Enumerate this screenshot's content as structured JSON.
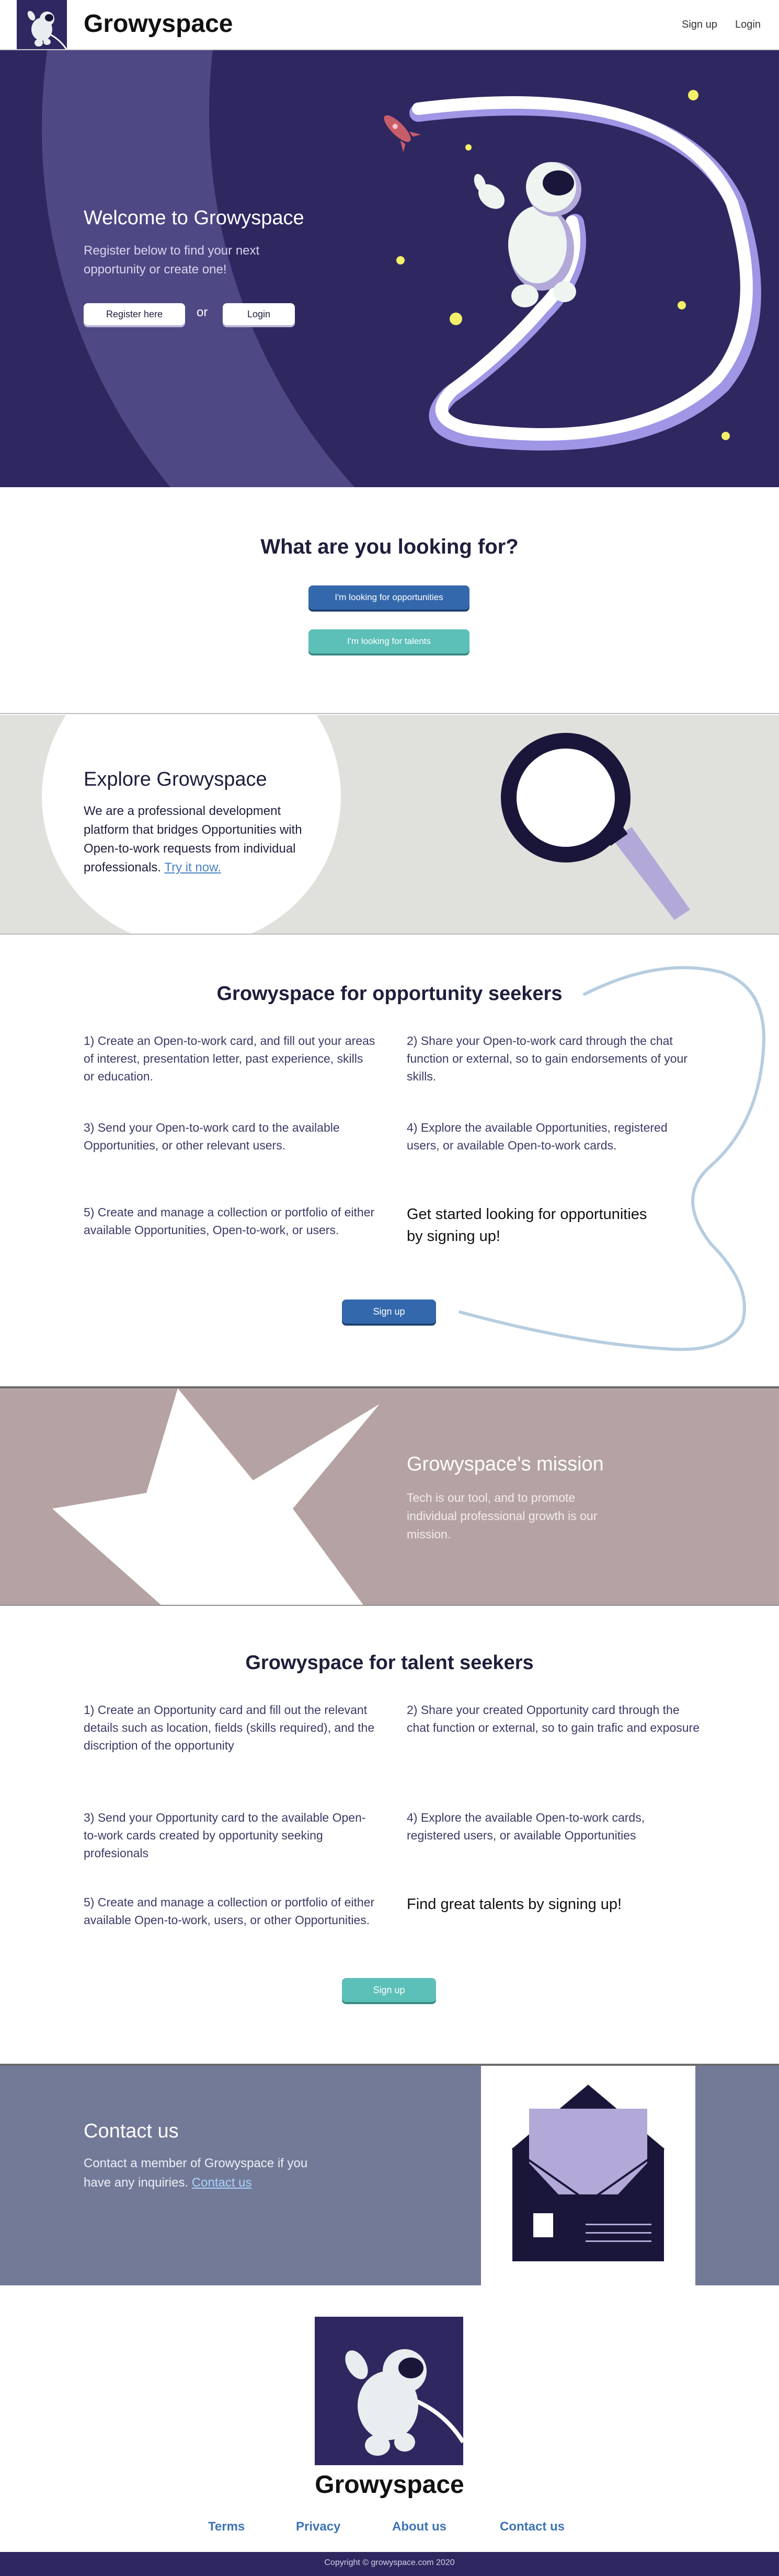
{
  "colors": {
    "brand_dark": "#2e2760",
    "primary_blue": "#3468ac",
    "teal": "#5cc0b8",
    "lavender": "#b3a9d8",
    "mission_bg": "#b5a3a3",
    "contact_bg": "#737a98",
    "explore_bg": "#e0e1dc"
  },
  "header": {
    "title": "Growyspace",
    "nav": {
      "signup": "Sign up",
      "login": "Login"
    }
  },
  "hero": {
    "title": "Welcome to Growyspace",
    "text": "Register below to find your next opportunity or create one!",
    "register_label": "Register here",
    "or_label": "or",
    "login_label": "Login"
  },
  "looking": {
    "title": "What are you looking for?",
    "opportunities_label": "I'm looking for opportunities",
    "talents_label": "I'm looking for talents"
  },
  "explore": {
    "title": "Explore Growyspace",
    "text": "We are a professional development platform that bridges Opportunities with Open-to-work requests from individual professionals. ",
    "link": "Try it now."
  },
  "opportunity_seekers": {
    "title": "Growyspace for opportunity seekers",
    "steps": [
      "1) Create an Open-to-work card, and fill out your areas of interest, presentation letter, past experience, skills or education.",
      "2) Share your Open-to-work card through the chat function or external, so to gain endorsements of your skills.",
      "3) Send your Open-to-work card to the available Opportunities, or other relevant users.",
      "4) Explore the available Opportunities, registered users, or available Open-to-work cards.",
      "5) Create and manage a collection or portfolio of either available Opportunities, Open-to-work, or users."
    ],
    "cta": "Get started looking for opportunities by signing up!",
    "signup_label": "Sign up"
  },
  "mission": {
    "title": "Growyspace's mission",
    "text": "Tech is our tool, and to promote individual professional growth is our mission."
  },
  "talent_seekers": {
    "title": "Growyspace for talent seekers",
    "steps": [
      "1) Create an Opportunity card and fill out the relevant details such as location, fields (skills required), and the discription of the opportunity",
      "2) Share your created Opportunity card through the chat function or external, so to gain trafic and exposure",
      "3) Send your Opportunity card to the available Open-to-work cards created by opportunity seeking profesionals",
      "4) Explore the available Open-to-work cards, registered users, or available Opportunities",
      "5) Create and manage a collection or portfolio of either available Open-to-work, users, or other Opportunities."
    ],
    "cta": "Find great talents by signing up!",
    "signup_label": "Sign up"
  },
  "contact": {
    "title": "Contact us",
    "text": "Contact a member of Growyspace if you have any inquiries. ",
    "link": "Contact us"
  },
  "footer": {
    "title": "Growyspace",
    "links": [
      "Terms",
      "Privacy",
      "About us",
      "Contact us"
    ],
    "copyright": "Copyright © growyspace.com 2020"
  }
}
